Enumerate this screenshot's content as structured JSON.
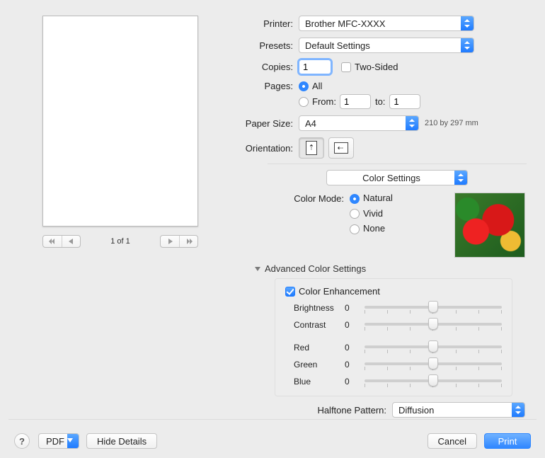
{
  "preview": {
    "page_counter": "1 of 1"
  },
  "printer": {
    "label": "Printer:",
    "value": "Brother MFC-XXXX"
  },
  "presets": {
    "label": "Presets:",
    "value": "Default Settings"
  },
  "copies": {
    "label": "Copies:",
    "value": "1",
    "two_sided_label": "Two-Sided",
    "two_sided_checked": false
  },
  "pages": {
    "label": "Pages:",
    "all_checked": true,
    "all_label": "All",
    "from_checked": false,
    "from_label": "From:",
    "from_value": "1",
    "to_label": "to:",
    "to_value": "1"
  },
  "paper_size": {
    "label": "Paper Size:",
    "value": "A4",
    "note": "210 by 297 mm"
  },
  "orientation": {
    "label": "Orientation:"
  },
  "section_popup": "Color Settings",
  "color_mode": {
    "label": "Color Mode:",
    "options": {
      "natural": "Natural",
      "vivid": "Vivid",
      "none": "None"
    },
    "selected": "natural"
  },
  "advanced": {
    "disclosure": "Advanced Color Settings",
    "color_enhancement_label": "Color Enhancement",
    "color_enhancement_checked": true,
    "sliders": {
      "brightness": {
        "label": "Brightness",
        "value": "0"
      },
      "contrast": {
        "label": "Contrast",
        "value": "0"
      },
      "red": {
        "label": "Red",
        "value": "0"
      },
      "green": {
        "label": "Green",
        "value": "0"
      },
      "blue": {
        "label": "Blue",
        "value": "0"
      }
    }
  },
  "halftone": {
    "label": "Halftone Pattern:",
    "value": "Diffusion"
  },
  "footer": {
    "pdf": "PDF",
    "hide_details": "Hide Details",
    "cancel": "Cancel",
    "print": "Print"
  }
}
